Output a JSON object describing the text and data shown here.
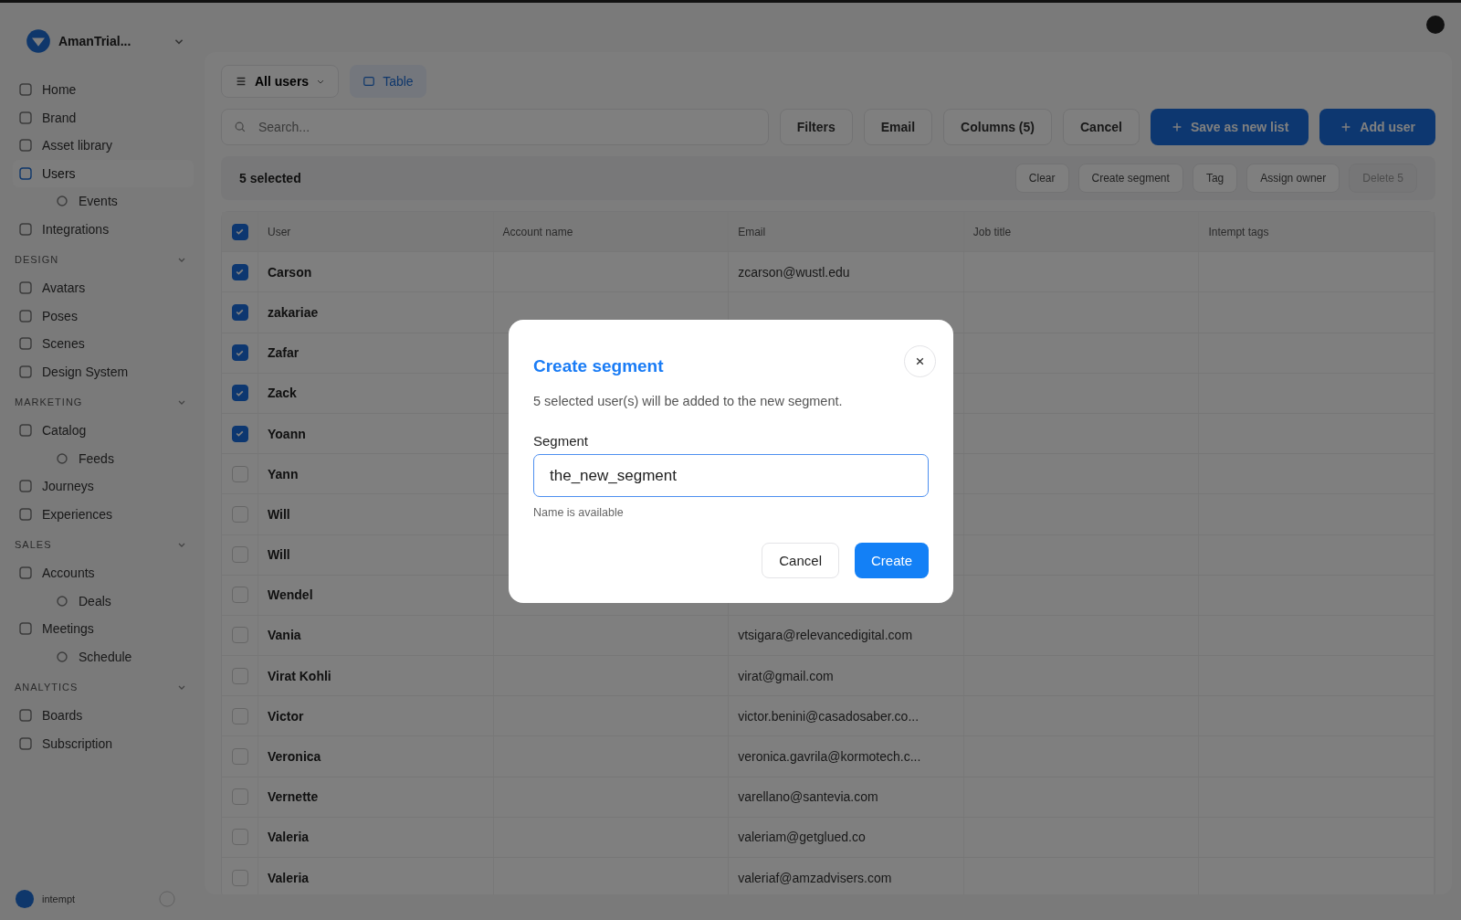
{
  "org": {
    "name": "AmanTrial..."
  },
  "nav": [
    {
      "kind": "item",
      "label": "Home",
      "selected": false
    },
    {
      "kind": "item",
      "label": "Brand",
      "selected": false
    },
    {
      "kind": "item",
      "label": "Asset library",
      "selected": false
    },
    {
      "kind": "item",
      "label": "Users",
      "selected": true,
      "children": [
        {
          "label": "Events",
          "selected": false
        }
      ]
    },
    {
      "kind": "item",
      "label": "Integrations",
      "selected": false
    },
    {
      "kind": "section",
      "label": "DESIGN",
      "expanded": true
    },
    {
      "kind": "item",
      "label": "Avatars",
      "selected": false
    },
    {
      "kind": "item",
      "label": "Poses",
      "selected": false
    },
    {
      "kind": "item",
      "label": "Scenes",
      "selected": false
    },
    {
      "kind": "item",
      "label": "Design System",
      "selected": false
    },
    {
      "kind": "section",
      "label": "MARKETING",
      "expanded": true
    },
    {
      "kind": "item",
      "label": "Catalog",
      "selected": false,
      "children": [
        {
          "label": "Feeds",
          "selected": false
        }
      ]
    },
    {
      "kind": "item",
      "label": "Journeys",
      "selected": false
    },
    {
      "kind": "item",
      "label": "Experiences",
      "selected": false
    },
    {
      "kind": "section",
      "label": "SALES",
      "expanded": true
    },
    {
      "kind": "item",
      "label": "Accounts",
      "selected": false,
      "children": [
        {
          "label": "Deals",
          "selected": false
        }
      ]
    },
    {
      "kind": "item",
      "label": "Meetings",
      "selected": false,
      "children": [
        {
          "label": "Schedule",
          "selected": false
        }
      ]
    },
    {
      "kind": "section",
      "label": "ANALYTICS",
      "expanded": true
    },
    {
      "kind": "item",
      "label": "Boards",
      "selected": false
    },
    {
      "kind": "item",
      "label": "Subscription",
      "selected": false
    }
  ],
  "footer": {
    "brand": "intempt"
  },
  "view": {
    "dropdown": "All users",
    "tab": "Table"
  },
  "search": {
    "placeholder": "Search..."
  },
  "toolbar": [
    {
      "kind": "plain",
      "label": "Filters"
    },
    {
      "kind": "plain",
      "label": "Email"
    },
    {
      "kind": "plain",
      "label": "Columns (5)"
    },
    {
      "kind": "plain",
      "label": "Cancel"
    },
    {
      "kind": "primary",
      "label": "Save as new list"
    },
    {
      "kind": "primary",
      "label": "Add user"
    }
  ],
  "selection": {
    "count": "5 selected",
    "actions": [
      {
        "label": "Clear",
        "disabled": false
      },
      {
        "label": "Create segment",
        "disabled": false
      },
      {
        "label": "Tag",
        "disabled": false
      },
      {
        "label": "Assign owner",
        "disabled": false
      },
      {
        "label": "Delete 5",
        "disabled": true
      }
    ]
  },
  "table": {
    "all_checked": true,
    "columns": [
      "User",
      "Account name",
      "Email",
      "Job title",
      "Intempt tags"
    ],
    "rows": [
      {
        "user": "Carson",
        "email": "zcarson@wustl.edu",
        "checked": true
      },
      {
        "user": "zakariae",
        "checked": true
      },
      {
        "user": "Zafar",
        "checked": true
      },
      {
        "user": "Zack",
        "checked": true
      },
      {
        "user": "Yoann",
        "checked": true
      },
      {
        "user": "Yann",
        "checked": false
      },
      {
        "user": "Will",
        "checked": false
      },
      {
        "user": "Will",
        "checked": false
      },
      {
        "user": "Wendel",
        "checked": false
      },
      {
        "user": "Vania",
        "email": "vtsigara@relevancedigital.com",
        "checked": false
      },
      {
        "user": "Virat Kohli",
        "email": "virat@gmail.com",
        "checked": false
      },
      {
        "user": "Victor",
        "email": "victor.benini@casadosaber.co...",
        "checked": false
      },
      {
        "user": "Veronica",
        "email": "veronica.gavrila@kormotech.c...",
        "checked": false
      },
      {
        "user": "Vernette",
        "email": "varellano@santevia.com",
        "checked": false
      },
      {
        "user": "Valeria",
        "email": "valeriam@getglued.co",
        "checked": false
      },
      {
        "user": "Valeria",
        "email": "valeriaf@amzadvisers.com",
        "checked": false
      }
    ]
  },
  "dialog": {
    "title": "Create segment",
    "description": "5 selected user(s) will be added to the new segment.",
    "field_label": "Segment",
    "value": "the_new_segment",
    "hint": "Name is available",
    "buttons": [
      {
        "kind": "secondary",
        "label": "Cancel"
      },
      {
        "kind": "primary",
        "label": "Create"
      }
    ]
  }
}
